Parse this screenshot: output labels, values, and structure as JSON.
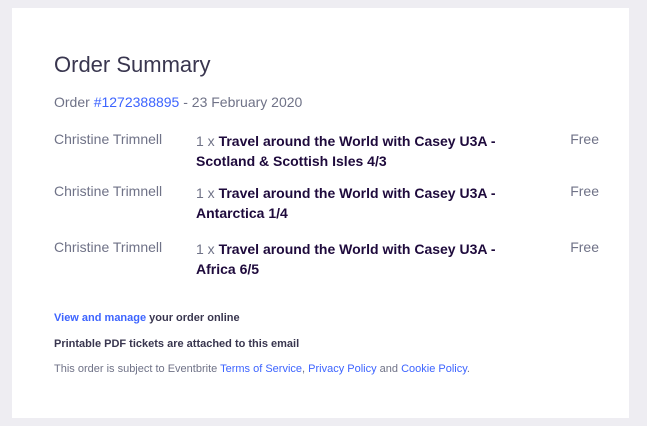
{
  "summary": {
    "title": "Order Summary",
    "order_prefix": "Order ",
    "order_number": "#1272388895",
    "order_date": " - 23 February 2020"
  },
  "items": [
    {
      "buyer": "Christine Trimnell",
      "qty": "1 x ",
      "event": "Travel around the World with Casey U3A - Scotland & Scottish Isles 4/3",
      "price": "Free"
    },
    {
      "buyer": "Christine Trimnell",
      "qty": "1 x ",
      "event": "Travel around the World with Casey U3A - Antarctica 1/4",
      "price": "Free"
    },
    {
      "buyer": "Christine Trimnell",
      "qty": "1 x ",
      "event": "Travel around the World with Casey U3A - Africa 6/5",
      "price": "Free"
    }
  ],
  "footer": {
    "manage_link": "View and manage",
    "manage_rest": " your order online",
    "pdf_note": "Printable PDF tickets are attached to this email",
    "terms_prefix": "This order is subject to Eventbrite ",
    "terms_link": "Terms of Service",
    "terms_sep": ", ",
    "privacy_link": "Privacy Policy",
    "terms_and": " and ",
    "cookie_link": "Cookie Policy",
    "terms_end": "."
  }
}
